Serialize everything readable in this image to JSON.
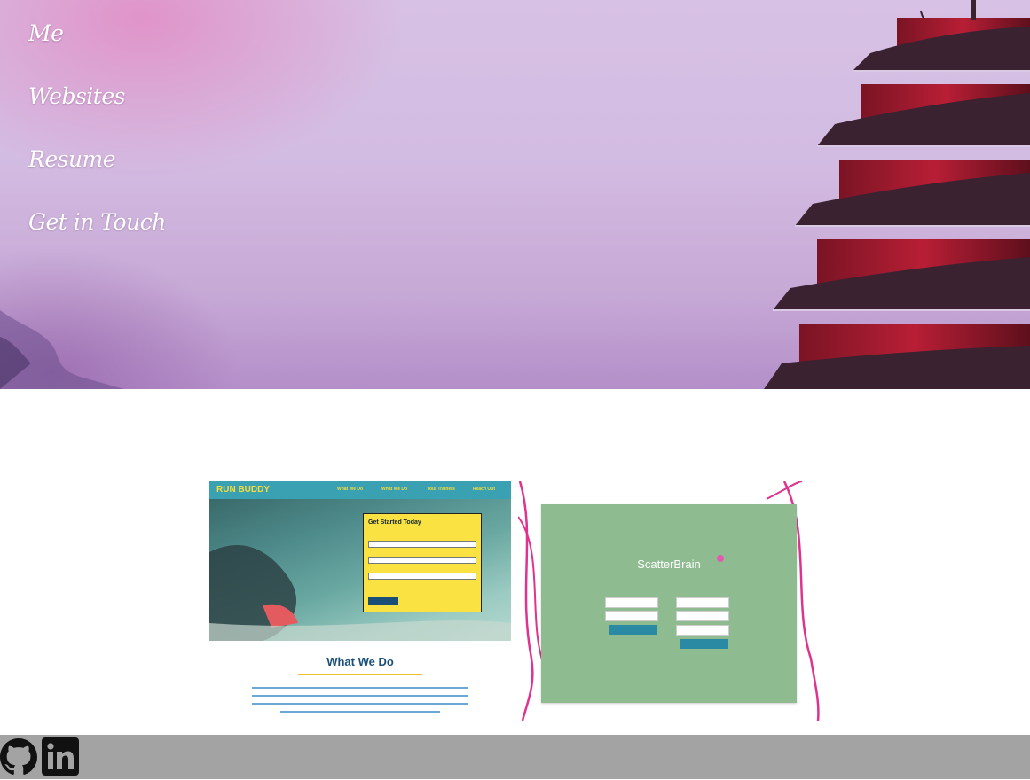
{
  "nav": {
    "links": [
      {
        "label": "Me"
      },
      {
        "label": "Websites"
      },
      {
        "label": "Resume"
      },
      {
        "label": "Get in Touch"
      }
    ]
  },
  "projects": [
    {
      "thumbnail": "run-buddy-screenshot",
      "site_logo": "RUN BUDDY",
      "site_nav": [
        "What We Do",
        "What We Do",
        "Your Trainers",
        "Reach Out"
      ],
      "form_title": "Get Started Today",
      "section_heading": "What We Do",
      "caption": ""
    },
    {
      "thumbnail": "scatterbrain-screenshot",
      "site_title": "ScatterBrain",
      "caption": ""
    }
  ],
  "footer": {
    "icons": [
      "github-icon",
      "linkedin-icon"
    ]
  },
  "colors": {
    "footer": "#a3a3a3",
    "nav_text": "#ffffff",
    "hero_tint": "#d3bce2"
  }
}
